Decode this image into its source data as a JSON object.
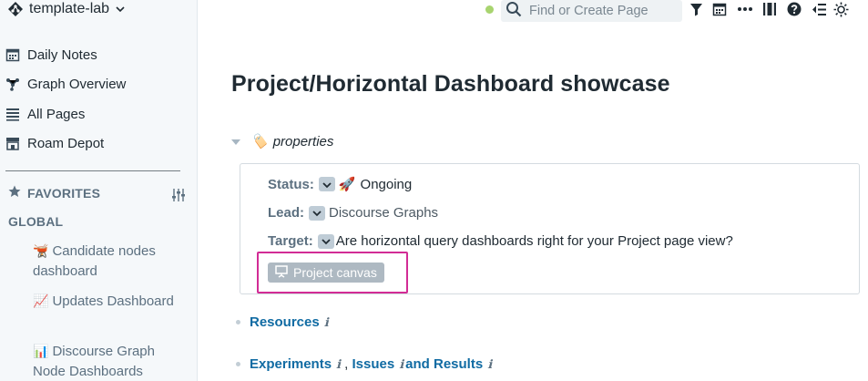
{
  "sidebar": {
    "graph_name": "template-lab",
    "nav": [
      {
        "label": "Daily Notes",
        "icon": "calendar-icon"
      },
      {
        "label": "Graph Overview",
        "icon": "graph-icon"
      },
      {
        "label": "All Pages",
        "icon": "list-icon"
      },
      {
        "label": "Roam Depot",
        "icon": "store-icon"
      }
    ],
    "favorites_label": "FAVORITES",
    "global_label": "GLOBAL",
    "shortcuts": [
      {
        "emoji": "🫕",
        "label": "Candidate nodes dashboard"
      },
      {
        "emoji": "📈",
        "label": "Updates Dashboard"
      },
      {
        "emoji": "📊",
        "label": "Discourse Graph Node Dashboards"
      }
    ]
  },
  "topbar": {
    "search_placeholder": "Find or Create Page",
    "status_color": "#8bc53f"
  },
  "page": {
    "title": "Project/Horizontal Dashboard showcase",
    "properties_emoji": "🏷️",
    "properties_label": "properties",
    "status_label": "Status:",
    "status_emoji": "🚀",
    "status_value": "Ongoing",
    "lead_label": "Lead:",
    "lead_value": "Discourse Graphs",
    "target_label": "Target:",
    "target_value": "Are horizontal query dashboards right for your Project page view?",
    "canvas_button": "Project canvas",
    "resources_link": "Resources",
    "experiments_link": "Experiments",
    "issues_link": "Issues",
    "results_link": "and Results",
    "info_glyph": "ℹ",
    "comma": " , "
  },
  "colors": {
    "link": "#106ba3",
    "highlight": "#d22c95"
  }
}
